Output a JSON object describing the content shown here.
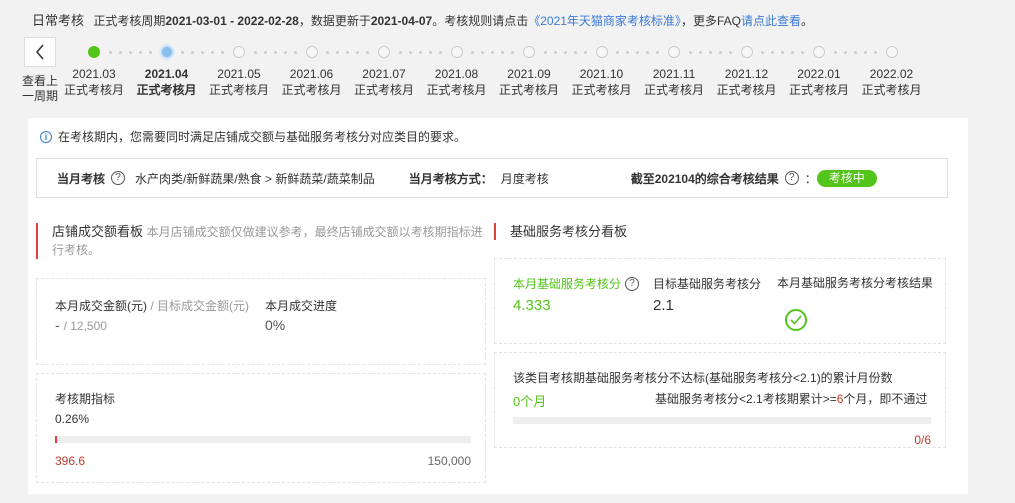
{
  "header": {
    "title": "日常考核",
    "period_prefix": "正式考核周期",
    "period_range": "2021-03-01 - 2022-02-28",
    "update_prefix": "，数据更新于",
    "update_date": "2021-04-07",
    "rule_text": "。考核规则请点击",
    "rule_link": "《2021年天猫商家考核标准》",
    "faq_prefix": "，更多FAQ",
    "faq_link": "请点此查看",
    "end": "。"
  },
  "prev": {
    "label": "查看上一周期"
  },
  "timeline": [
    {
      "month": "2021.03",
      "label": "正式考核月",
      "state": "done"
    },
    {
      "month": "2021.04",
      "label": "正式考核月",
      "state": "current"
    },
    {
      "month": "2021.05",
      "label": "正式考核月",
      "state": "future"
    },
    {
      "month": "2021.06",
      "label": "正式考核月",
      "state": "future"
    },
    {
      "month": "2021.07",
      "label": "正式考核月",
      "state": "future"
    },
    {
      "month": "2021.08",
      "label": "正式考核月",
      "state": "future"
    },
    {
      "month": "2021.09",
      "label": "正式考核月",
      "state": "future"
    },
    {
      "month": "2021.10",
      "label": "正式考核月",
      "state": "future"
    },
    {
      "month": "2021.11",
      "label": "正式考核月",
      "state": "future"
    },
    {
      "month": "2021.12",
      "label": "正式考核月",
      "state": "future"
    },
    {
      "month": "2022.01",
      "label": "正式考核月",
      "state": "future"
    },
    {
      "month": "2022.02",
      "label": "正式考核月",
      "state": "future"
    }
  ],
  "notice": "在考核期内，您需要同时满足店铺成交额与基础服务考核分对应类目的要求。",
  "summary": {
    "month_check_label": "当月考核",
    "category": "水产肉类/新鲜蔬果/熟食 > 新鲜蔬菜/蔬菜制品",
    "method_label": "当月考核方式：",
    "method_value": "月度考核",
    "result_label": "截至202104的综合考核结果",
    "result_colon": "：",
    "result_badge": "考核中"
  },
  "gmv": {
    "title": "店铺成交额看板",
    "subtitle": "本月店铺成交额仅做建议参考，最终店铺成交额以考核期指标进行考核。",
    "amount_label": "本月成交金额(元)",
    "target_label": " / 目标成交金额(元)",
    "amount_value": "-",
    "target_value": "/ 12,500",
    "progress_label": "本月成交进度",
    "progress_value": "0%",
    "period_label": "考核期指标",
    "period_percent": "0.26%",
    "period_fraction": 0.0026,
    "period_current": "396.6",
    "period_target": "150,000"
  },
  "service": {
    "title": "基础服务考核分看板",
    "score_label": "本月基础服务考核分",
    "score_value": "4.333",
    "target_label": "目标基础服务考核分",
    "target_value": "2.1",
    "result_label": "本月基础服务考核分考核结果",
    "fail_title": "该类目考核期基础服务考核分不达标(基础服务考核分<2.1)的累计月份数",
    "fail_count": "0个月",
    "rule_prefix": "基础服务考核分<2.1考核期累计>=",
    "rule_num": "6",
    "rule_suffix": "个月，即不通过",
    "fail_fraction": 0,
    "fail_ratio": "0/6"
  },
  "colors": {
    "accent_green": "#52c41a",
    "accent_red": "#e0403a",
    "link_blue": "#3a7bd5"
  }
}
